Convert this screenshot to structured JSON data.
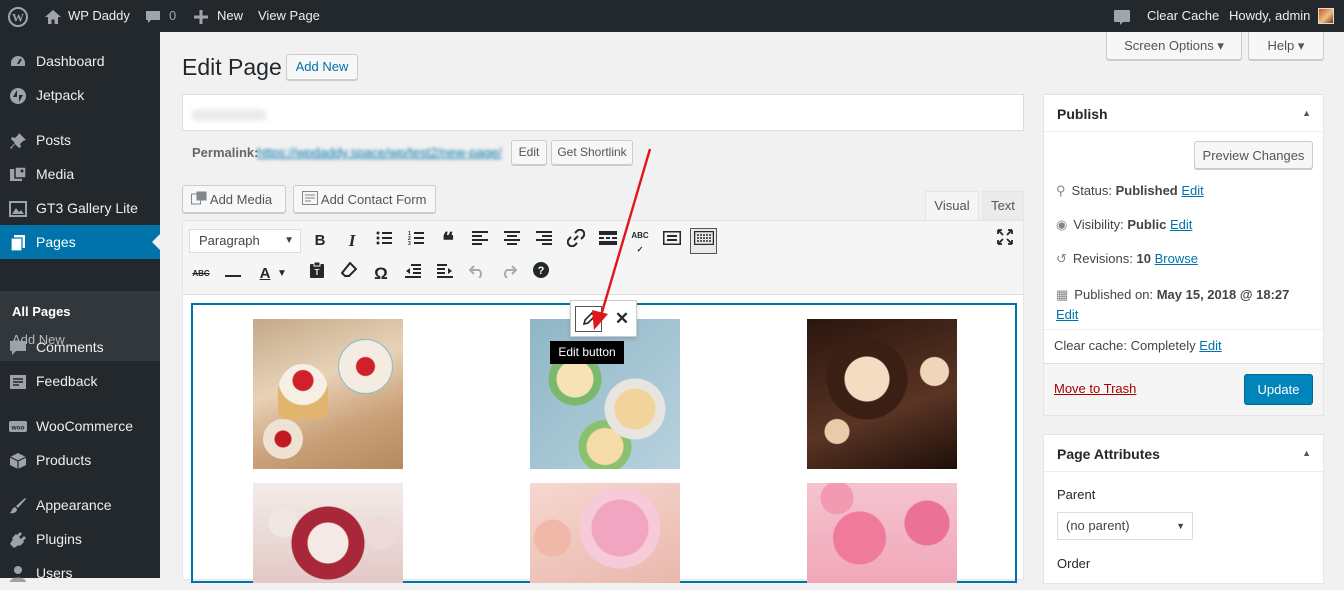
{
  "adminbar": {
    "site": "WP Daddy",
    "comments": "0",
    "new": "New",
    "view": "View Page",
    "clear_cache": "Clear Cache",
    "howdy": "Howdy, admin"
  },
  "sidebar": {
    "items": [
      {
        "label": "Dashboard",
        "icon": "dashboard-icon"
      },
      {
        "label": "Jetpack",
        "icon": "jetpack-icon"
      },
      {
        "label": "Posts",
        "icon": "pin-icon"
      },
      {
        "label": "Media",
        "icon": "media-icon"
      },
      {
        "label": "GT3 Gallery Lite",
        "icon": "gallery-icon"
      },
      {
        "label": "Pages",
        "icon": "pages-icon"
      },
      {
        "label": "Comments",
        "icon": "comments-icon"
      },
      {
        "label": "Feedback",
        "icon": "feedback-icon"
      },
      {
        "label": "WooCommerce",
        "icon": "woocommerce-icon"
      },
      {
        "label": "Products",
        "icon": "products-icon"
      },
      {
        "label": "Appearance",
        "icon": "brush-icon"
      },
      {
        "label": "Plugins",
        "icon": "plugin-icon"
      },
      {
        "label": "Users",
        "icon": "users-icon"
      }
    ],
    "sub": {
      "all_pages": "All Pages",
      "add_new": "Add New"
    }
  },
  "header": {
    "screen_options": "Screen Options",
    "help": "Help",
    "title": "Edit Page",
    "add_new": "Add New"
  },
  "permalink": {
    "label": "Permalink:",
    "url": "https://wpdaddy.space/wp/test2/new-page/",
    "edit": "Edit",
    "shortlink": "Get Shortlink"
  },
  "editor": {
    "add_media": "Add Media",
    "add_contact_form": "Add Contact Form",
    "tab_visual": "Visual",
    "tab_text": "Text",
    "format": "Paragraph",
    "tooltip": "Edit button",
    "popup_edit_icon": "pencil-icon",
    "popup_remove_icon": "close-icon"
  },
  "publish": {
    "title": "Publish",
    "preview": "Preview Changes",
    "status_label": "Status:",
    "status_value": "Published",
    "visibility_label": "Visibility:",
    "visibility_value": "Public",
    "revisions_label": "Revisions:",
    "revisions_value": "10",
    "browse": "Browse",
    "published_label": "Published on:",
    "published_value": "May 15, 2018 @ 18:27",
    "edit": "Edit",
    "clear_cache_label": "Clear cache:",
    "clear_cache_value": "Completely",
    "trash": "Move to Trash",
    "update": "Update"
  },
  "attributes": {
    "title": "Page Attributes",
    "parent_label": "Parent",
    "parent_value": "(no parent)",
    "order_label": "Order"
  },
  "colors": {
    "accent": "#0073aa",
    "adminbar": "#23282d",
    "arrow": "#e0161c"
  }
}
